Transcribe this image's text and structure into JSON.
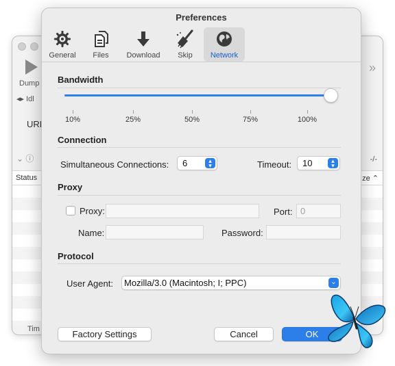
{
  "background_window": {
    "button_label": "Dump",
    "status_text": "Idl",
    "url_label": "URL",
    "dash_text": "-/-",
    "column_status": "Status",
    "column_size": "ze",
    "footer_text": "Tim"
  },
  "preferences": {
    "title": "Preferences",
    "tabs": [
      {
        "label": "General",
        "icon": "gear-icon"
      },
      {
        "label": "Files",
        "icon": "files-icon"
      },
      {
        "label": "Download",
        "icon": "download-arrow-icon"
      },
      {
        "label": "Skip",
        "icon": "broom-icon"
      },
      {
        "label": "Network",
        "icon": "globe-icon"
      }
    ],
    "active_tab": "Network",
    "bandwidth": {
      "title": "Bandwidth",
      "slider_value_fraction": 1.0,
      "ticks": [
        "10%",
        "25%",
        "50%",
        "75%",
        "100%"
      ]
    },
    "connection": {
      "title": "Connection",
      "simultaneous_label": "Simultaneous Connections:",
      "simultaneous_value": "6",
      "timeout_label": "Timeout:",
      "timeout_value": "10"
    },
    "proxy": {
      "title": "Proxy",
      "proxy_label": "Proxy:",
      "proxy_checked": false,
      "proxy_value": "",
      "port_label": "Port:",
      "port_placeholder": "0",
      "name_label": "Name:",
      "name_value": "",
      "password_label": "Password:",
      "password_value": ""
    },
    "protocol": {
      "title": "Protocol",
      "user_agent_label": "User Agent:",
      "user_agent_value": "Mozilla/3.0 (Macintosh; I; PPC)"
    },
    "buttons": {
      "factory": "Factory Settings",
      "cancel": "Cancel",
      "ok": "OK"
    }
  },
  "colors": {
    "accent": "#2c7fe8",
    "active_tab_label": "#1a5fd0"
  }
}
